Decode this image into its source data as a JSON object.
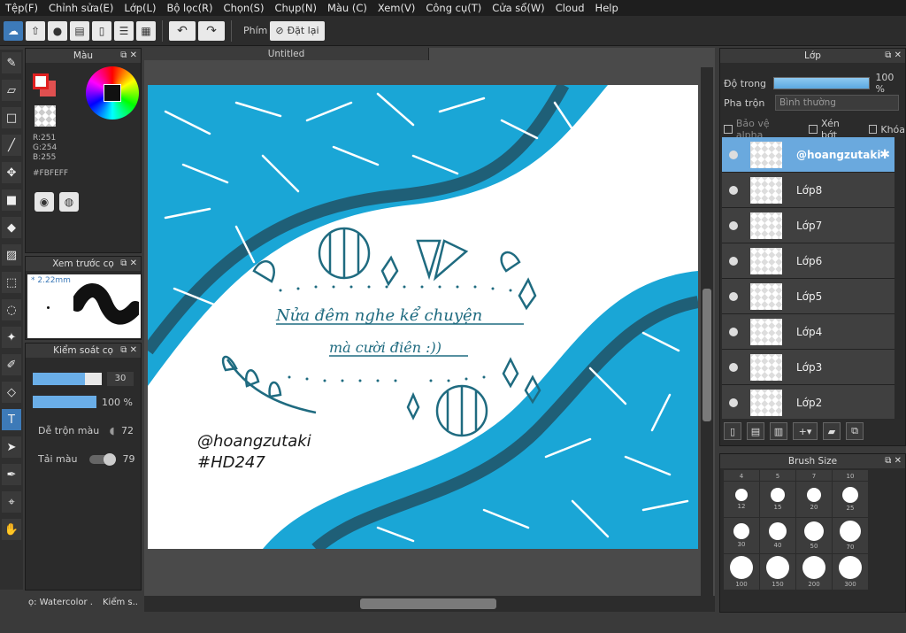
{
  "menu": [
    "Tệp(F)",
    "Chỉnh sửa(E)",
    "Lớp(L)",
    "Bộ lọc(R)",
    "Chọn(S)",
    "Chụp(N)",
    "Màu (C)",
    "Xem(V)",
    "Công cụ(T)",
    "Cửa sổ(W)",
    "Cloud",
    "Help"
  ],
  "toolbar": {
    "shortcut_label": "Phím",
    "reset_label": "Đặt lại"
  },
  "color_panel": {
    "title": "Màu",
    "r": "R:251",
    "g": "G:254",
    "b": "B:255",
    "hex": "#FBFEFF"
  },
  "preview_panel": {
    "title": "Xem trước cọ",
    "size": "2.22mm"
  },
  "brush_control": {
    "title": "Kiểm soát cọ",
    "size_value": "30",
    "size_fraction": 0.75,
    "opacity_value": "100 %",
    "opacity_fraction": 1.0,
    "blend_label": "Dễ trộn màu",
    "blend_value": "72",
    "load_label": "Tải màu",
    "load_value": "79"
  },
  "bottom_tabs": [
    "ọ: Watercolor .",
    "Kiểm s.."
  ],
  "document": {
    "tab_title": "Untitled",
    "art_line1": "Nửa đêm nghe kể chuyện",
    "art_line2": "mà cười điên :))",
    "handle": "@hoangzutaki",
    "tag": "#HD247",
    "colors": {
      "blue": "#1aa6d6",
      "dark": "#1f5f77"
    }
  },
  "layer_panel": {
    "title": "Lớp",
    "opacity_label": "Độ trong",
    "opacity_value": "100 %",
    "blend_label": "Pha trộn",
    "blend_value": "Bình thường",
    "protect_alpha": "Bảo vệ alpha",
    "clip": "Xén bớt",
    "lock": "Khóa",
    "layers": [
      {
        "name": "@hoangzutaki",
        "selected": true
      },
      {
        "name": "Lớp8",
        "selected": false
      },
      {
        "name": "Lớp7",
        "selected": false
      },
      {
        "name": "Lớp6",
        "selected": false
      },
      {
        "name": "Lớp5",
        "selected": false
      },
      {
        "name": "Lớp4",
        "selected": false
      },
      {
        "name": "Lớp3",
        "selected": false
      },
      {
        "name": "Lớp2",
        "selected": false
      }
    ]
  },
  "brush_size_panel": {
    "title": "Brush Size",
    "top_row": [
      "4",
      "5",
      "7",
      "10"
    ],
    "sizes": [
      "12",
      "15",
      "20",
      "25",
      "30",
      "40",
      "50",
      "70",
      "100",
      "150",
      "200",
      "300"
    ]
  }
}
